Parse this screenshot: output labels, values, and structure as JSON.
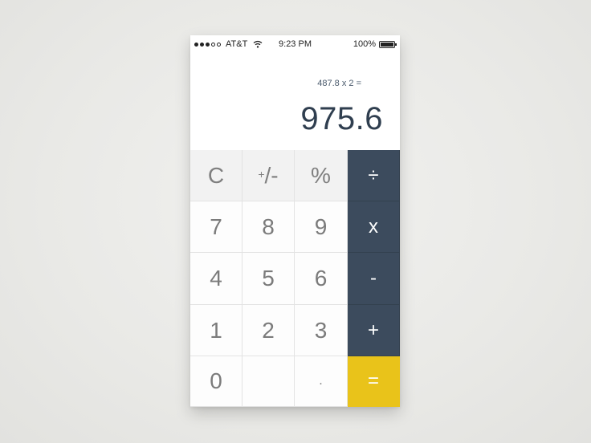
{
  "status_bar": {
    "carrier": "AT&T",
    "time": "9:23 PM",
    "battery": "100%"
  },
  "display": {
    "expression": "487.8 x 2 =",
    "result": "975.6"
  },
  "keys": {
    "clear": "C",
    "plus_minus_sup": "+",
    "plus_minus_rest": "/-",
    "percent": "%",
    "divide": "÷",
    "multiply": "x",
    "subtract": "-",
    "add": "+",
    "equals": "=",
    "seven": "7",
    "eight": "8",
    "nine": "9",
    "four": "4",
    "five": "5",
    "six": "6",
    "one": "1",
    "two": "2",
    "three": "3",
    "zero": "0",
    "decimal": "."
  },
  "colors": {
    "operator_bg": "#3c4b5d",
    "equals_bg": "#e9c31a",
    "result_text": "#2f3e4f"
  }
}
